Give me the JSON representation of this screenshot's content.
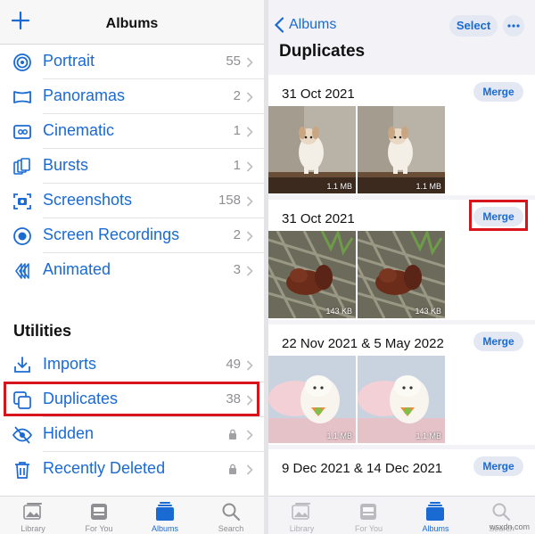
{
  "left": {
    "header": {
      "title": "Albums"
    },
    "media_types": [
      {
        "label": "Portrait",
        "count": "55",
        "icon": "portrait-icon"
      },
      {
        "label": "Panoramas",
        "count": "2",
        "icon": "panorama-icon"
      },
      {
        "label": "Cinematic",
        "count": "1",
        "icon": "cinematic-icon"
      },
      {
        "label": "Bursts",
        "count": "1",
        "icon": "bursts-icon"
      },
      {
        "label": "Screenshots",
        "count": "158",
        "icon": "screenshot-icon"
      },
      {
        "label": "Screen Recordings",
        "count": "2",
        "icon": "screen-recording-icon"
      },
      {
        "label": "Animated",
        "count": "3",
        "icon": "animated-icon"
      }
    ],
    "utilities_title": "Utilities",
    "utilities": [
      {
        "label": "Imports",
        "count": "49",
        "icon": "import-icon"
      },
      {
        "label": "Duplicates",
        "count": "38",
        "icon": "duplicates-icon"
      },
      {
        "label": "Hidden",
        "count": "",
        "icon": "hidden-icon",
        "locked": true
      },
      {
        "label": "Recently Deleted",
        "count": "",
        "icon": "trash-icon",
        "locked": true
      }
    ],
    "tabs": [
      "Library",
      "For You",
      "Albums",
      "Search"
    ],
    "active_tab": "Albums"
  },
  "right": {
    "back_label": "Albums",
    "select_label": "Select",
    "title": "Duplicates",
    "merge_label": "Merge",
    "groups": [
      {
        "date": "31 Oct 2021",
        "sizes": [
          "1.1 MB",
          "1.1 MB"
        ],
        "subject": "puppy"
      },
      {
        "date": "31 Oct 2021",
        "sizes": [
          "143 KB",
          "143 KB"
        ],
        "subject": "squirrel"
      },
      {
        "date": "22 Nov 2021 & 5 May 2022",
        "sizes": [
          "1.1 MB",
          "1.1 MB"
        ],
        "subject": "plush-toy"
      },
      {
        "date": "9 Dec 2021 & 14 Dec 2021",
        "sizes": [],
        "subject": ""
      }
    ],
    "tabs": [
      "Library",
      "For You",
      "Albums",
      "Search"
    ],
    "active_tab": "Albums"
  },
  "watermark": "wsxdn.com",
  "colors": {
    "accent": "#1a6ad4",
    "highlight": "#d7141b",
    "muted": "#8e8e93"
  }
}
